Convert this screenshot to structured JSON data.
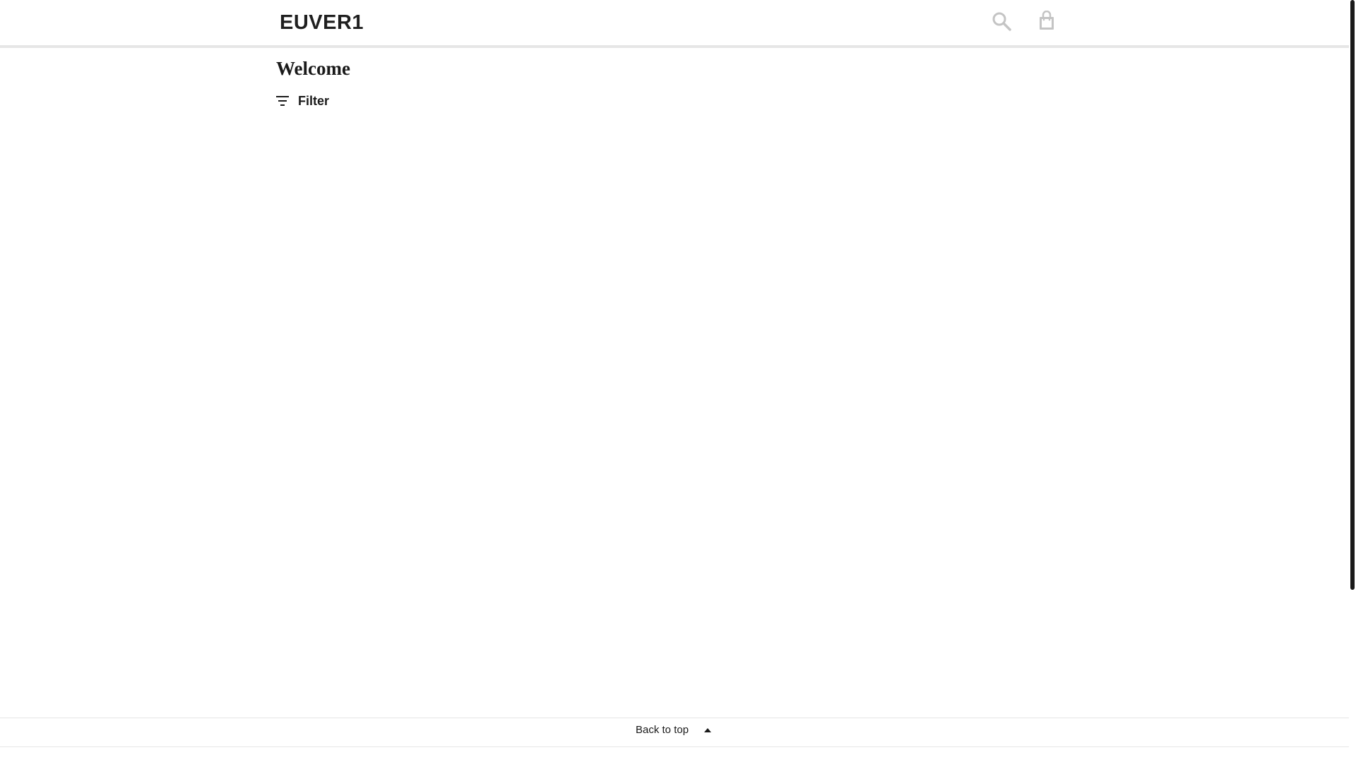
{
  "header": {
    "brand": "EUVER1",
    "icons": {
      "search": "search-icon",
      "bag": "shopping-bag-icon"
    },
    "icon_color": "#c4c4c4"
  },
  "main": {
    "title": "Welcome",
    "filter_label": "Filter",
    "filter_icon": "filter-icon"
  },
  "footer": {
    "back_to_top_label": "Back to top",
    "back_to_top_icon": "caret-up-icon"
  },
  "colors": {
    "background": "#ffffff",
    "text": "#1a1a1a",
    "divider": "#e6e6e6",
    "scrollbar_thumb": "#1a1a1a"
  }
}
